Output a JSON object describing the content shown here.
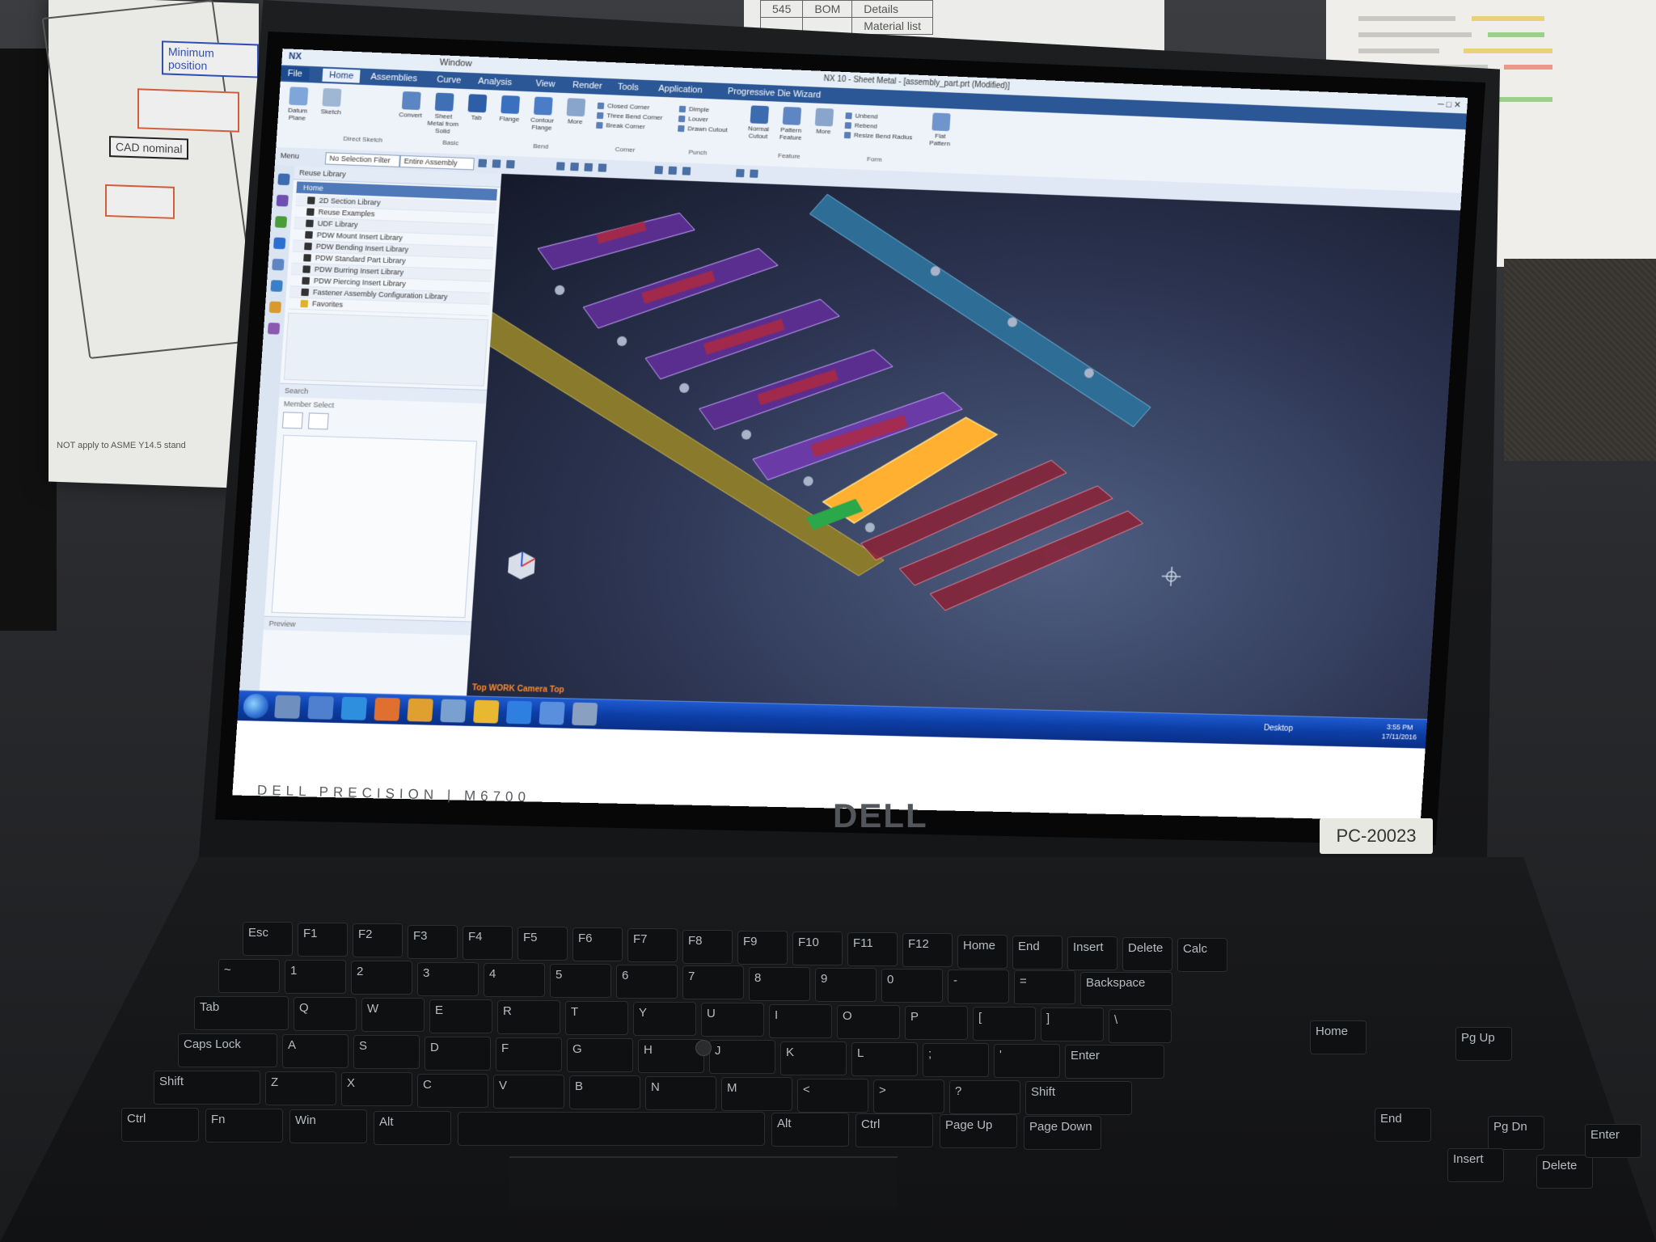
{
  "wall": {
    "notes": [
      "Minimum position",
      "CAD nominal"
    ],
    "wall_text": "NOT apply to ASME Y14.5 stand",
    "table_cells": [
      "545",
      "BOM",
      "Details",
      "Material list"
    ]
  },
  "laptop": {
    "model": "DELL PRECISION | M6700",
    "brand": "DELL",
    "asset_tag": "PC-20023"
  },
  "nx": {
    "quick_access": "NX",
    "window_menu": "Window",
    "window_title": "NX 10 - Sheet Metal - [assembly_part.prt (Modified)]",
    "tabs": [
      "File",
      "Home",
      "Assemblies",
      "Curve",
      "Analysis",
      "View",
      "Render",
      "Tools",
      "Application",
      "Progressive Die Wizard"
    ],
    "ribbon": {
      "buttons": [
        "Datum Plane",
        "Sketch",
        "Convert",
        "Sheet Metal from Solid",
        "Tab",
        "Flange",
        "Contour Flange",
        "More",
        "Normal Cutout",
        "Pattern Feature",
        "More",
        "Flat Pattern"
      ],
      "group_direct_sketch": "Direct Sketch",
      "group_basic": "Basic",
      "group_bend": "Bend",
      "group_corner": "Corner",
      "group_punch": "Punch",
      "group_feature": "Feature",
      "group_form": "Form",
      "corner_list": [
        "Closed Corner",
        "Three Bend Corner",
        "Break Corner"
      ],
      "punch_list": [
        "Dimple",
        "Louver",
        "Drawn Cutout"
      ],
      "form_list": [
        "Unbend",
        "Rebend",
        "Resize Bend Radius"
      ]
    },
    "toolbar": {
      "menu": "Menu",
      "filter": "No Selection Filter",
      "scope": "Entire Assembly"
    },
    "reuse_library": {
      "title": "Reuse Library",
      "home": "Home",
      "items": [
        "2D Section Library",
        "Reuse Examples",
        "UDF Library",
        "PDW Mount Insert Library",
        "PDW Bending Insert Library",
        "PDW Standard Part Library",
        "PDW Burring Insert Library",
        "PDW Piercing Insert Library",
        "Fastener Assembly Configuration Library",
        "Favorites"
      ],
      "search_label": "Search",
      "member_select_label": "Member Select",
      "preview_label": "Preview"
    },
    "viewport_label": "Top WORK Camera Top"
  },
  "taskbar": {
    "desktop_label": "Desktop",
    "time": "3:55 PM",
    "date": "17/11/2016"
  },
  "keyboard": {
    "row_fn": [
      "Esc",
      "F1",
      "F2",
      "F3",
      "F4",
      "F5",
      "F6",
      "F7",
      "F8",
      "F9",
      "F10",
      "F11",
      "F12",
      "Home",
      "End",
      "Insert",
      "Delete",
      "Calc"
    ],
    "row_num": [
      "~",
      "1",
      "2",
      "3",
      "4",
      "5",
      "6",
      "7",
      "8",
      "9",
      "0",
      "-",
      "=",
      "Backspace"
    ],
    "row_q": [
      "Tab",
      "Q",
      "W",
      "E",
      "R",
      "T",
      "Y",
      "U",
      "I",
      "O",
      "P",
      "[",
      "]",
      "\\"
    ],
    "row_a": [
      "Caps Lock",
      "A",
      "S",
      "D",
      "F",
      "G",
      "H",
      "J",
      "K",
      "L",
      ";",
      "'",
      "Enter"
    ],
    "row_z": [
      "Shift",
      "Z",
      "X",
      "C",
      "V",
      "B",
      "N",
      "M",
      "<",
      ">",
      "?",
      "Shift"
    ],
    "row_bottom": [
      "Ctrl",
      "Fn",
      "Win",
      "Alt",
      "",
      "Alt",
      "Ctrl",
      "Page Up",
      "Page Down"
    ],
    "numpad_labels": [
      "Home",
      "Pg Up",
      "End",
      "Pg Dn",
      "Insert",
      "Delete",
      "Enter"
    ]
  },
  "colors": {
    "nx_blue": "#2b5797",
    "ribbon_bg": "#eef3fa",
    "viewport_dark": "#2b3350",
    "highlight_orange": "#ffb030",
    "taskbar_blue": "#0c3ea6"
  }
}
